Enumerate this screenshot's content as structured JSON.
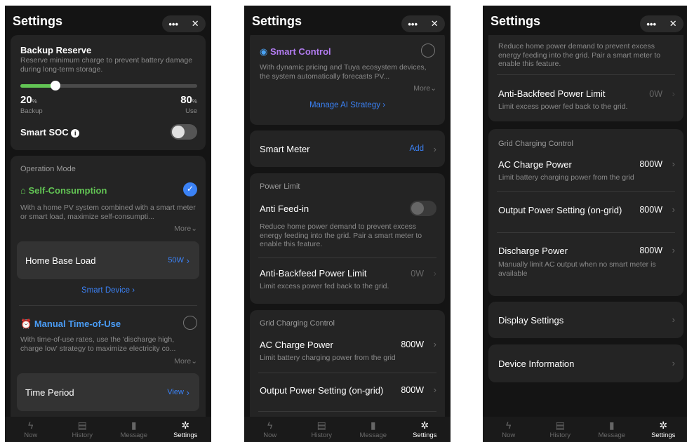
{
  "header": {
    "title": "Settings",
    "more_icon": "•••",
    "close_icon": "✕"
  },
  "nav": [
    {
      "label": "Now",
      "icon": "lightning-icon"
    },
    {
      "label": "History",
      "icon": "history-icon"
    },
    {
      "label": "Message",
      "icon": "message-icon"
    },
    {
      "label": "Settings",
      "icon": "gear-icon",
      "active": true
    }
  ],
  "screen1": {
    "backup": {
      "title": "Backup Reserve",
      "desc": "Reserve minimum charge to prevent battery damage during long-term storage.",
      "backup_value": "20",
      "backup_unit": "%",
      "backup_label": "Backup",
      "use_value": "80",
      "use_unit": "%",
      "use_label": "Use",
      "reserve_percent": 20
    },
    "smart_soc": {
      "label": "Smart SOC",
      "info_icon": "i"
    },
    "operation": {
      "section": "Operation Mode",
      "self": {
        "title": "Self-Consumption",
        "desc": "With a home PV system combined with a smart meter or smart load, maximize self-consumpti...",
        "more": "More",
        "home_base_load": "Home Base Load",
        "home_base_value": "50W",
        "smart_device": "Smart Device"
      },
      "manual": {
        "title": "Manual Time-of-Use",
        "desc": "With time-of-use rates, use the 'discharge high, charge low' strategy to maximize electricity co...",
        "more": "More",
        "time_period": "Time Period",
        "view": "View"
      }
    }
  },
  "screen2": {
    "smart_control": {
      "title": "Smart Control",
      "desc": "With dynamic pricing and Tuya ecosystem devices, the system automatically forecasts PV...",
      "more": "More",
      "manage": "Manage AI Strategy"
    },
    "smart_meter": {
      "label": "Smart Meter",
      "action": "Add"
    },
    "power_limit": {
      "section": "Power Limit",
      "anti_feed": "Anti Feed-in",
      "anti_feed_desc": "Reduce home power demand to prevent excess energy feeding into the grid. Pair a smart meter to enable this feature.",
      "anti_backfeed": "Anti-Backfeed Power Limit",
      "anti_backfeed_value": "0W",
      "anti_backfeed_desc": "Limit excess power fed back to the grid."
    },
    "grid": {
      "section": "Grid Charging Control",
      "ac_charge": "AC Charge Power",
      "ac_charge_value": "800W",
      "ac_charge_desc": "Limit battery charging power from the grid",
      "output": "Output Power Setting (on-grid)",
      "output_value": "800W"
    }
  },
  "screen3": {
    "top_desc": "Reduce home power demand to prevent excess energy feeding into the grid. Pair a smart meter to enable this feature.",
    "anti_backfeed": "Anti-Backfeed Power Limit",
    "anti_backfeed_value": "0W",
    "anti_backfeed_desc": "Limit excess power fed back to the grid.",
    "grid": {
      "section": "Grid Charging Control",
      "ac_charge": "AC Charge Power",
      "ac_charge_value": "800W",
      "ac_charge_desc": "Limit battery charging power from the grid",
      "output": "Output Power Setting (on-grid)",
      "output_value": "800W",
      "discharge": "Discharge Power",
      "discharge_value": "800W",
      "discharge_desc": "Manually limit AC output when no smart meter is available"
    },
    "display": "Display Settings",
    "device_info": "Device Information"
  }
}
